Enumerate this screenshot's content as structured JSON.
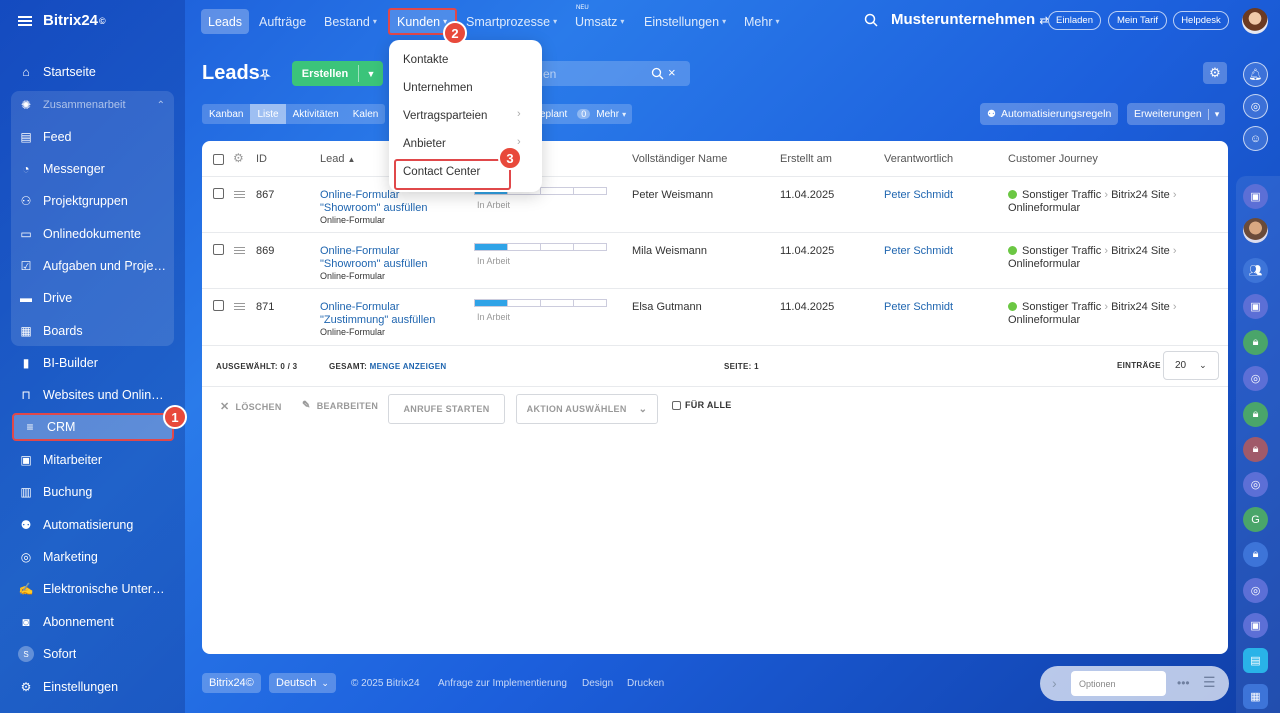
{
  "brand": {
    "name": "Bitrix24",
    "mark": "©"
  },
  "sidebar": {
    "items": [
      {
        "label": "Startseite",
        "icon": "home-icon"
      },
      {
        "label": "Zusammenarbeit",
        "icon": "collaboration-icon"
      },
      {
        "label": "Feed",
        "icon": "feed-icon"
      },
      {
        "label": "Messenger",
        "icon": "messenger-icon"
      },
      {
        "label": "Projektgruppen",
        "icon": "groups-icon"
      },
      {
        "label": "Onlinedokumente",
        "icon": "document-icon"
      },
      {
        "label": "Aufgaben und Projek...",
        "icon": "tasks-icon"
      },
      {
        "label": "Drive",
        "icon": "drive-icon"
      },
      {
        "label": "Boards",
        "icon": "boards-icon"
      },
      {
        "label": "BI-Builder",
        "icon": "bi-chart-icon"
      },
      {
        "label": "Websites und Onlines...",
        "icon": "cart-icon"
      },
      {
        "label": "CRM",
        "icon": "crm-filter-icon"
      },
      {
        "label": "Mitarbeiter",
        "icon": "employees-icon"
      },
      {
        "label": "Buchung",
        "icon": "calendar-icon"
      },
      {
        "label": "Automatisierung",
        "icon": "robot-icon"
      },
      {
        "label": "Marketing",
        "icon": "target-icon"
      },
      {
        "label": "Elektronische Untersc...",
        "icon": "signature-icon"
      },
      {
        "label": "Abonnement",
        "icon": "subscription-icon"
      },
      {
        "label": "Sofort",
        "icon": "sofort-icon",
        "initial": "S"
      },
      {
        "label": "Einstellungen",
        "icon": "gear-icon"
      }
    ]
  },
  "topnav": {
    "tabs": [
      "Leads",
      "Aufträge",
      "Bestand",
      "Kunden",
      "Smartprozesse",
      "Umsatz",
      "Einstellungen",
      "Mehr"
    ],
    "neu_badge": "NEU",
    "company": "Musterunternehmen",
    "buttons": [
      "Einladen",
      "Mein Tarif",
      "Helpdesk"
    ]
  },
  "header": {
    "title": "Leads",
    "create_label": "Erstellen",
    "search_placeholder": "en"
  },
  "views": [
    "Kanban",
    "Liste",
    "Aktivitäten",
    "Kalen"
  ],
  "views_extra": {
    "planned": "eplant",
    "count": "0",
    "more": "Mehr"
  },
  "toolbar": {
    "automation": "Automatisierungsregeln",
    "extensions": "Erweiterungen"
  },
  "table": {
    "columns": [
      "ID",
      "Lead",
      "Vollständiger Name",
      "Erstellt am",
      "Verantwortlich",
      "Customer Journey"
    ],
    "rows": [
      {
        "id": "867",
        "lead_line1": "Online-Formular",
        "lead_line2": "\"Showroom\" ausfüllen",
        "source": "Online-Formular",
        "stage": "In Arbeit",
        "name": "Peter Weismann",
        "created": "11.04.2025",
        "responsible": "Peter Schmidt",
        "journey1": "Sonstiger Traffic",
        "journey2": "Bitrix24 Site",
        "journey3": "Onlineformular"
      },
      {
        "id": "869",
        "lead_line1": "Online-Formular",
        "lead_line2": "\"Showroom\" ausfüllen",
        "source": "Online-Formular",
        "stage": "In Arbeit",
        "name": "Mila Weismann",
        "created": "11.04.2025",
        "responsible": "Peter Schmidt",
        "journey1": "Sonstiger Traffic",
        "journey2": "Bitrix24 Site",
        "journey3": "Onlineformular"
      },
      {
        "id": "871",
        "lead_line1": "Online-Formular",
        "lead_line2": "\"Zustimmung\" ausfüllen",
        "source": "Online-Formular",
        "stage": "In Arbeit",
        "name": "Elsa Gutmann",
        "created": "11.04.2025",
        "responsible": "Peter Schmidt",
        "journey1": "Sonstiger Traffic",
        "journey2": "Bitrix24 Site",
        "journey3": "Onlineformular"
      }
    ],
    "stage_progress": 0.25
  },
  "footer": {
    "selected_label": "AUSGEWÄHLT:",
    "selected_value": "0 / 3",
    "total_label": "GESAMT:",
    "total_link": "MENGE ANZEIGEN",
    "page_label": "SEITE:",
    "page_value": "1",
    "entries_label": "EINTRÄGE",
    "entries_value": "20"
  },
  "actions": {
    "delete": "LÖSCHEN",
    "edit": "BEARBEITEN",
    "calls": "ANRUFE STARTEN",
    "select_action": "AKTION AUSWÄHLEN",
    "for_all": "FÜR ALLE"
  },
  "dropdown": {
    "items": [
      "Kontakte",
      "Unternehmen",
      "Vertragsparteien",
      "Anbieter",
      "Contact Center"
    ]
  },
  "badges": [
    "1",
    "2",
    "3"
  ],
  "bottom": {
    "brand": "Bitrix24©",
    "language": "Deutsch",
    "copyright": "© 2025 Bitrix24",
    "links": [
      "Anfrage zur Implementierung",
      "Design",
      "Drucken"
    ],
    "options_placeholder": "Optionen"
  },
  "colors": {
    "accent_green": "#3bc47a",
    "highlight_red": "#e0484a",
    "link_blue": "#2066b0",
    "stage_blue": "#2fa3e7"
  }
}
